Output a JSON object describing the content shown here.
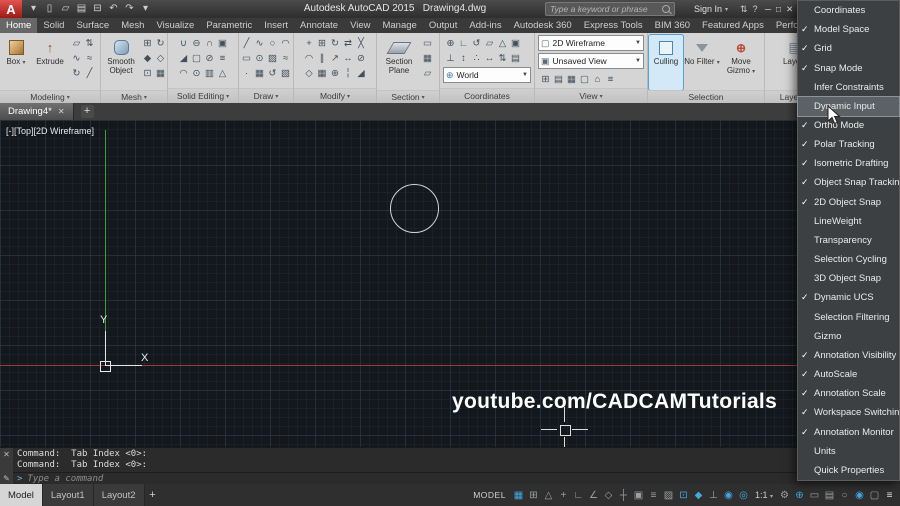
{
  "titlebar": {
    "logo_letter": "A",
    "app_title": "Autodesk AutoCAD 2015",
    "doc_title": "Drawing4.dwg",
    "search_placeholder": "Type a keyword or phrase",
    "sign_in_label": "Sign In",
    "quick_access": [
      {
        "name": "app-menu-arrow-icon",
        "glyph": "▾"
      },
      {
        "name": "new-file-icon",
        "glyph": "▯"
      },
      {
        "name": "open-file-icon",
        "glyph": "▱"
      },
      {
        "name": "save-icon",
        "glyph": "▤"
      },
      {
        "name": "plot-icon",
        "glyph": "⊟"
      },
      {
        "name": "undo-icon",
        "glyph": "↶"
      },
      {
        "name": "redo-icon",
        "glyph": "↷"
      },
      {
        "name": "workspace-dropdown-icon",
        "glyph": "▾"
      }
    ],
    "right_icons": [
      {
        "name": "exchange-apps-icon",
        "glyph": "⇅"
      },
      {
        "name": "help-icon",
        "glyph": "?"
      }
    ],
    "window_controls": [
      {
        "name": "minimize-button",
        "glyph": "─"
      },
      {
        "name": "maximize-button",
        "glyph": "□"
      },
      {
        "name": "close-button",
        "glyph": "✕"
      }
    ]
  },
  "ribbon": {
    "tabs": [
      {
        "label": "Home",
        "active": true,
        "name": "tab-home"
      },
      {
        "label": "Solid",
        "name": "tab-solid"
      },
      {
        "label": "Surface",
        "name": "tab-surface"
      },
      {
        "label": "Mesh",
        "name": "tab-mesh"
      },
      {
        "label": "Visualize",
        "name": "tab-visualize"
      },
      {
        "label": "Parametric",
        "name": "tab-parametric"
      },
      {
        "label": "Insert",
        "name": "tab-insert"
      },
      {
        "label": "Annotate",
        "name": "tab-annotate"
      },
      {
        "label": "View",
        "name": "tab-view"
      },
      {
        "label": "Manage",
        "name": "tab-manage"
      },
      {
        "label": "Output",
        "name": "tab-output"
      },
      {
        "label": "Add-ins",
        "name": "tab-add-ins"
      },
      {
        "label": "Autodesk 360",
        "name": "tab-autodesk-360"
      },
      {
        "label": "Express Tools",
        "name": "tab-express-tools"
      },
      {
        "label": "BIM 360",
        "name": "tab-bim-360"
      },
      {
        "label": "Featured Apps",
        "name": "tab-featured-apps"
      },
      {
        "label": "Perform",
        "name": "tab-performance"
      }
    ],
    "modeling": {
      "label": "Modeling",
      "box_label": "Box",
      "extrude_label": "Extrude",
      "small_icons": [
        {
          "name": "polysolid-icon",
          "glyph": "▱"
        },
        {
          "name": "presspull-icon",
          "glyph": "⇅"
        },
        {
          "name": "sweep-icon",
          "glyph": "∿"
        },
        {
          "name": "loft-icon",
          "glyph": "≈"
        },
        {
          "name": "revolve-icon",
          "glyph": "↻"
        },
        {
          "name": "slice-icon",
          "glyph": "╱"
        }
      ]
    },
    "mesh": {
      "label": "Mesh",
      "smooth_object_label": "Smooth Object",
      "small_icons": [
        {
          "name": "mesh-box-icon",
          "glyph": "⊞"
        },
        {
          "name": "revolved-mesh-icon",
          "glyph": "↻"
        },
        {
          "name": "smooth-more-icon",
          "glyph": "◆"
        },
        {
          "name": "smooth-less-icon",
          "glyph": "◇"
        },
        {
          "name": "refine-mesh-icon",
          "glyph": "⊡"
        },
        {
          "name": "edge-mesh-icon",
          "glyph": "▦"
        }
      ]
    },
    "solid_editing": {
      "label": "Solid Editing",
      "small_icons": [
        {
          "name": "union-icon",
          "glyph": "∪"
        },
        {
          "name": "subtract-icon",
          "glyph": "⊖"
        },
        {
          "name": "intersect-icon",
          "glyph": "∩"
        },
        {
          "name": "extrude-faces-icon",
          "glyph": "▣"
        },
        {
          "name": "taper-faces-icon",
          "glyph": "◢"
        },
        {
          "name": "shell-icon",
          "glyph": "▢"
        },
        {
          "name": "separate-icon",
          "glyph": "⊘"
        },
        {
          "name": "imprint-icon",
          "glyph": "≡"
        },
        {
          "name": "fillet-edge-icon",
          "glyph": "◠"
        },
        {
          "name": "offset-edge-icon",
          "glyph": "⊙"
        },
        {
          "name": "clean-icon",
          "glyph": "▥"
        },
        {
          "name": "check-solid-icon",
          "glyph": "△"
        }
      ]
    },
    "draw": {
      "label": "Draw",
      "small_icons": [
        {
          "name": "line-icon",
          "glyph": "╱"
        },
        {
          "name": "polyline-icon",
          "glyph": "∿"
        },
        {
          "name": "circle-icon",
          "glyph": "○"
        },
        {
          "name": "arc-icon",
          "glyph": "◠"
        },
        {
          "name": "rectangle-icon",
          "glyph": "▭"
        },
        {
          "name": "ellipse-icon",
          "glyph": "⊙"
        },
        {
          "name": "hatch-icon",
          "glyph": "▨"
        },
        {
          "name": "spline-icon",
          "glyph": "≈"
        },
        {
          "name": "point-icon",
          "glyph": "·"
        },
        {
          "name": "region-icon",
          "glyph": "▦"
        },
        {
          "name": "helix-icon",
          "glyph": "↺"
        },
        {
          "name": "gradient-icon",
          "glyph": "▧"
        }
      ]
    },
    "modify": {
      "label": "Modify",
      "small_icons": [
        {
          "name": "move-icon",
          "glyph": "+"
        },
        {
          "name": "copy-icon",
          "glyph": "⊞"
        },
        {
          "name": "rotate-icon",
          "glyph": "↻"
        },
        {
          "name": "mirror-icon",
          "glyph": "⇄"
        },
        {
          "name": "trim-icon",
          "glyph": "╳"
        },
        {
          "name": "fillet-icon",
          "glyph": "◠"
        },
        {
          "name": "offset-icon",
          "glyph": "∥"
        },
        {
          "name": "scale-icon",
          "glyph": "↗"
        },
        {
          "name": "stretch-icon",
          "glyph": "↔"
        },
        {
          "name": "erase-icon",
          "glyph": "⊘"
        },
        {
          "name": "explode-icon",
          "glyph": "◇"
        },
        {
          "name": "array-icon",
          "glyph": "▦"
        },
        {
          "name": "join-icon",
          "glyph": "⊕"
        },
        {
          "name": "break-icon",
          "glyph": "╎"
        },
        {
          "name": "chamfer-icon",
          "glyph": "◢"
        }
      ]
    },
    "section": {
      "label": "Section",
      "section_plane_label": "Section Plane",
      "small_icons": [
        {
          "name": "section-boundary-icon",
          "glyph": "▭"
        },
        {
          "name": "section-volume-icon",
          "glyph": "▦"
        },
        {
          "name": "live-section-icon",
          "glyph": "▱"
        }
      ]
    },
    "coordinates": {
      "label": "Coordinates",
      "ucs_dropdown_value": "World",
      "small_icons": [
        {
          "name": "ucs-world-icon",
          "glyph": "⊕"
        },
        {
          "name": "ucs-icon",
          "glyph": "∟"
        },
        {
          "name": "ucs-previous-icon",
          "glyph": "↺"
        },
        {
          "name": "ucs-face-icon",
          "glyph": "▱"
        },
        {
          "name": "ucs-object-icon",
          "glyph": "△"
        },
        {
          "name": "ucs-view-icon",
          "glyph": "▣"
        },
        {
          "name": "ucs-origin-icon",
          "glyph": "⊥"
        },
        {
          "name": "ucs-z-axis-icon",
          "glyph": "↕"
        },
        {
          "name": "ucs-3point-icon",
          "glyph": "∴"
        },
        {
          "name": "ucs-x-rotate-icon",
          "glyph": "↔"
        },
        {
          "name": "ucs-y-rotate-icon",
          "glyph": "⇅"
        },
        {
          "name": "named-ucs-icon",
          "glyph": "▤"
        }
      ]
    },
    "view": {
      "label": "View",
      "visual_style_value": "2D Wireframe",
      "named_view_value": "Unsaved View",
      "small_icons": [
        {
          "name": "viewport-config-icon",
          "glyph": "⊞"
        },
        {
          "name": "named-views-icon",
          "glyph": "▤"
        },
        {
          "name": "new-viewport-icon",
          "glyph": "▦"
        },
        {
          "name": "join-viewport-icon",
          "glyph": "▢"
        },
        {
          "name": "restore-viewport-icon",
          "glyph": "⌂"
        },
        {
          "name": "viewport-overlay-icon",
          "glyph": "≡"
        }
      ]
    },
    "selection": {
      "label": "Selection",
      "culling_label": "Culling",
      "no_filter_label": "No Filter",
      "move_gizmo_label": "Move Gizmo"
    },
    "layers": {
      "label": "Layers",
      "big_button_label": "Layers"
    }
  },
  "doc_tabs": {
    "tabs": [
      {
        "label": "Drawing4*",
        "active": true,
        "name": "doc-tab-drawing4"
      }
    ],
    "add_label": "+"
  },
  "viewport": {
    "controls": "[-][Top][2D Wireframe]",
    "ucs_x_label": "X",
    "ucs_y_label": "Y"
  },
  "command": {
    "history": [
      "Command:  Tab Index <0>:",
      "Command:  Tab Index <0>:"
    ],
    "prompt": ">",
    "input_placeholder": "Type a command",
    "close_glyph": "✕",
    "customize_glyph": "✎"
  },
  "statusbar": {
    "layout_tabs": [
      {
        "label": "Model",
        "active": true,
        "name": "layout-tab-model"
      },
      {
        "label": "Layout1",
        "name": "layout-tab-layout1"
      },
      {
        "label": "Layout2",
        "name": "layout-tab-layout2"
      }
    ],
    "add_layout_label": "+",
    "model_label": "MODEL",
    "scale_label": "1:1",
    "icons": [
      {
        "name": "grid-toggle-icon",
        "glyph": "▦",
        "color": "#3fa9e0"
      },
      {
        "name": "snap-mode-icon",
        "glyph": "⊞",
        "color": "#9aa0a4"
      },
      {
        "name": "infer-constraints-icon",
        "glyph": "△",
        "color": "#9aa0a4"
      },
      {
        "name": "dynamic-input-icon",
        "glyph": "+",
        "color": "#9aa0a4"
      },
      {
        "name": "ortho-mode-icon",
        "glyph": "∟",
        "color": "#9aa0a4"
      },
      {
        "name": "polar-tracking-icon",
        "glyph": "∠",
        "color": "#9aa0a4"
      },
      {
        "name": "isometric-drafting-icon",
        "glyph": "◇",
        "color": "#9aa0a4"
      },
      {
        "name": "osnap-tracking-icon",
        "glyph": "┼",
        "color": "#9aa0a4"
      },
      {
        "name": "object-snap-icon",
        "glyph": "▣",
        "color": "#9aa0a4"
      },
      {
        "name": "lineweight-icon",
        "glyph": "≡",
        "color": "#9aa0a4"
      },
      {
        "name": "transparency-icon",
        "glyph": "▨",
        "color": "#9aa0a4"
      },
      {
        "name": "selection-cycling-icon",
        "glyph": "⊡",
        "color": "#3fa9e0"
      },
      {
        "name": "3d-object-snap-icon",
        "glyph": "◆",
        "color": "#3fa9e0"
      },
      {
        "name": "dynamic-ucs-icon",
        "glyph": "⊥",
        "color": "#9aa0a4"
      },
      {
        "name": "annotation-visibility-icon",
        "glyph": "◉",
        "color": "#3fa9e0"
      },
      {
        "name": "autoscale-icon",
        "glyph": "◎",
        "color": "#3fa9e0"
      }
    ],
    "icons2": [
      {
        "name": "workspace-switching-icon",
        "glyph": "⚙",
        "color": "#9aa0a4"
      },
      {
        "name": "annotation-monitor-icon",
        "glyph": "⊕",
        "color": "#3fa9e0"
      },
      {
        "name": "units-icon",
        "glyph": "▭",
        "color": "#9aa0a4"
      },
      {
        "name": "quick-properties-icon",
        "glyph": "▤",
        "color": "#9aa0a4"
      },
      {
        "name": "isolate-objects-icon",
        "glyph": "○",
        "color": "#9aa0a4"
      },
      {
        "name": "graphics-performance-icon",
        "glyph": "◉",
        "color": "#3fa9e0"
      },
      {
        "name": "clean-screen-icon",
        "glyph": "▢",
        "color": "#9aa0a4"
      },
      {
        "name": "customize-icon",
        "glyph": "≡",
        "color": "#e0e0e0"
      }
    ]
  },
  "context_menu": {
    "items": [
      {
        "label": "Coordinates",
        "checked": false,
        "name": "menu-item-coordinates"
      },
      {
        "label": "Model Space",
        "checked": true,
        "name": "menu-item-model-space"
      },
      {
        "label": "Grid",
        "checked": true,
        "name": "menu-item-grid"
      },
      {
        "label": "Snap Mode",
        "checked": true,
        "name": "menu-item-snap-mode"
      },
      {
        "label": "Infer Constraints",
        "checked": false,
        "name": "menu-item-infer-constraints"
      },
      {
        "label": "Dynamic Input",
        "checked": false,
        "highlighted": true,
        "name": "menu-item-dynamic-input"
      },
      {
        "label": "Ortho Mode",
        "checked": true,
        "name": "menu-item-ortho-mode"
      },
      {
        "label": "Polar Tracking",
        "checked": true,
        "name": "menu-item-polar-tracking"
      },
      {
        "label": "Isometric Drafting",
        "checked": true,
        "name": "menu-item-isometric-drafting"
      },
      {
        "label": "Object Snap Tracking",
        "checked": true,
        "name": "menu-item-object-snap-tracking"
      },
      {
        "label": "2D Object Snap",
        "checked": true,
        "name": "menu-item-2d-object-snap"
      },
      {
        "label": "LineWeight",
        "checked": false,
        "name": "menu-item-lineweight"
      },
      {
        "label": "Transparency",
        "checked": false,
        "name": "menu-item-transparency"
      },
      {
        "label": "Selection Cycling",
        "checked": false,
        "name": "menu-item-selection-cycling"
      },
      {
        "label": "3D Object Snap",
        "checked": false,
        "name": "menu-item-3d-object-snap"
      },
      {
        "label": "Dynamic UCS",
        "checked": true,
        "name": "menu-item-dynamic-ucs"
      },
      {
        "label": "Selection Filtering",
        "checked": false,
        "name": "menu-item-selection-filtering"
      },
      {
        "label": "Gizmo",
        "checked": false,
        "name": "menu-item-gizmo"
      },
      {
        "label": "Annotation Visibility",
        "checked": true,
        "name": "menu-item-annotation-visibility"
      },
      {
        "label": "AutoScale",
        "checked": true,
        "name": "menu-item-autoscale"
      },
      {
        "label": "Annotation Scale",
        "checked": true,
        "name": "menu-item-annotation-scale"
      },
      {
        "label": "Workspace Switching",
        "checked": true,
        "name": "menu-item-workspace-switching"
      },
      {
        "label": "Annotation Monitor",
        "checked": true,
        "name": "menu-item-annotation-monitor"
      },
      {
        "label": "Units",
        "checked": false,
        "name": "menu-item-units"
      },
      {
        "label": "Quick Properties",
        "checked": false,
        "name": "menu-item-quick-properties"
      }
    ]
  },
  "watermark": {
    "text": "youtube.com/CADCAMTutorials"
  },
  "colors": {
    "accent_blue": "#3fa9e0",
    "ribbon_bg": "#d5d5d5",
    "canvas_bg": "#14181d",
    "axis_x_red": "#9e3a3a",
    "axis_y_green": "#3f9e3f",
    "menu_bg": "#3d4042",
    "culling_highlight": "#d3e9f8",
    "logo_red": "#c22a20"
  }
}
